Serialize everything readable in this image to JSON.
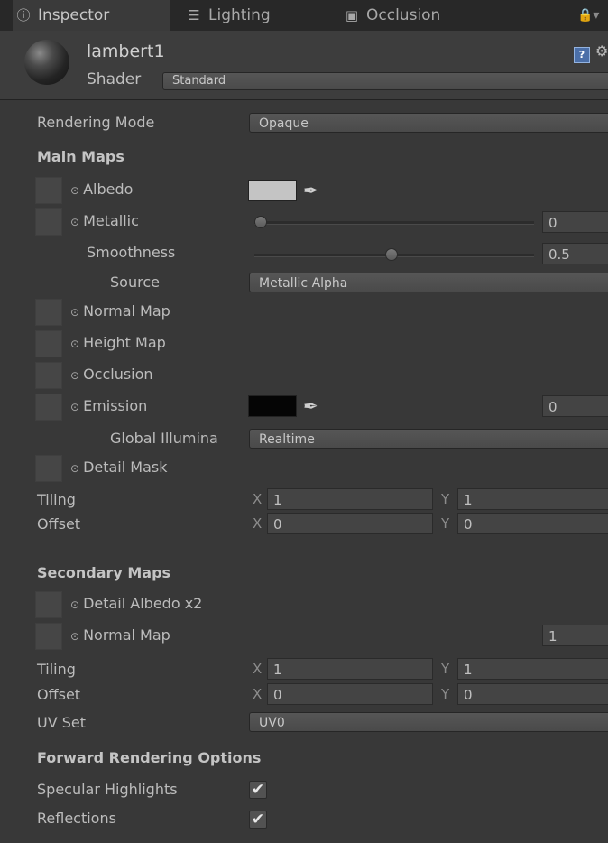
{
  "tabs": [
    {
      "label": "Inspector",
      "icon": "info-icon"
    },
    {
      "label": "Lighting",
      "icon": "sliders-icon"
    },
    {
      "label": "Occlusion",
      "icon": "occlusion-icon"
    }
  ],
  "header": {
    "material_name": "lambert1",
    "shader_label": "Shader",
    "shader_value": "Standard"
  },
  "rendering_mode": {
    "label": "Rendering Mode",
    "value": "Opaque"
  },
  "main_maps": {
    "title": "Main Maps",
    "albedo": {
      "label": "Albedo",
      "color": "#c4c4c4"
    },
    "metallic": {
      "label": "Metallic",
      "value": "0",
      "level": 0
    },
    "smoothness": {
      "label": "Smoothness",
      "value": "0.5",
      "level": 0.5
    },
    "source": {
      "label": "Source",
      "value": "Metallic Alpha"
    },
    "normal_map": {
      "label": "Normal Map"
    },
    "height_map": {
      "label": "Height Map"
    },
    "occlusion": {
      "label": "Occlusion"
    },
    "emission": {
      "label": "Emission",
      "color": "#050505",
      "value": "0"
    },
    "global_illumination": {
      "label": "Global Illumina",
      "value": "Realtime"
    },
    "detail_mask": {
      "label": "Detail Mask"
    },
    "tiling": {
      "label": "Tiling",
      "x_label": "X",
      "x": "1",
      "y_label": "Y",
      "y": "1"
    },
    "offset": {
      "label": "Offset",
      "x_label": "X",
      "x": "0",
      "y_label": "Y",
      "y": "0"
    }
  },
  "secondary_maps": {
    "title": "Secondary Maps",
    "detail_albedo": {
      "label": "Detail Albedo x2"
    },
    "normal_map": {
      "label": "Normal Map",
      "value": "1"
    },
    "tiling": {
      "label": "Tiling",
      "x_label": "X",
      "x": "1",
      "y_label": "Y",
      "y": "1"
    },
    "offset": {
      "label": "Offset",
      "x_label": "X",
      "x": "0",
      "y_label": "Y",
      "y": "0"
    },
    "uv_set": {
      "label": "UV Set",
      "value": "UV0"
    }
  },
  "forward_rendering": {
    "title": "Forward Rendering Options",
    "specular_highlights": {
      "label": "Specular Highlights",
      "checked": true
    },
    "reflections": {
      "label": "Reflections",
      "checked": true
    }
  },
  "picker_glyph": "⊙",
  "check_glyph": "✔"
}
